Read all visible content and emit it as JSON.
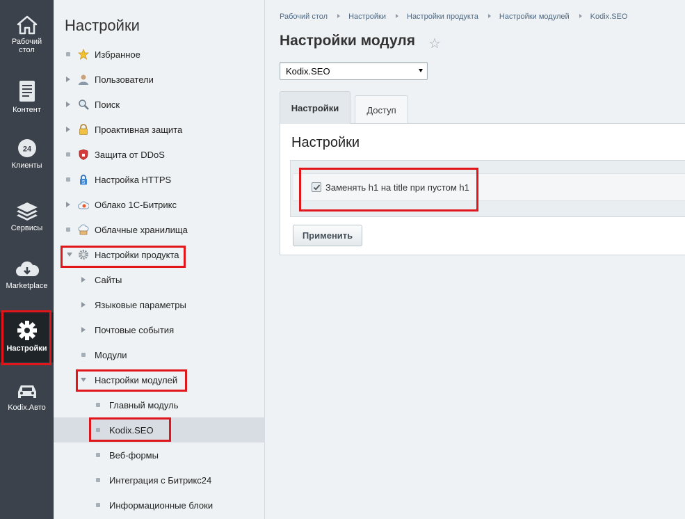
{
  "left_panel": {
    "items": [
      {
        "label": "Рабочий стол",
        "icon": "home-icon"
      },
      {
        "label": "Контент",
        "icon": "document-icon"
      },
      {
        "label": "Клиенты",
        "icon": "clients-24-icon"
      },
      {
        "label": "Сервисы",
        "icon": "layers-icon"
      },
      {
        "label": "Marketplace",
        "icon": "cloud-download-icon"
      },
      {
        "label": "Настройки",
        "icon": "gear-icon"
      },
      {
        "label": "Kodix.Авто",
        "icon": "car-icon"
      }
    ],
    "desktop_line1": "Рабочий",
    "desktop_line2": "стол"
  },
  "menu": {
    "title": "Настройки",
    "items": [
      {
        "label": "Избранное",
        "icon": "star-icon"
      },
      {
        "label": "Пользователи",
        "icon": "user-icon"
      },
      {
        "label": "Поиск",
        "icon": "magnifier-icon"
      },
      {
        "label": "Проактивная защита",
        "icon": "lock-icon"
      },
      {
        "label": "Защита от DDoS",
        "icon": "shield-icon"
      },
      {
        "label": "Настройка HTTPS",
        "icon": "https-lock-icon"
      },
      {
        "label": "Облако 1С-Битрикс",
        "icon": "cloud-icon"
      },
      {
        "label": "Облачные хранилища",
        "icon": "cloud-storage-icon"
      },
      {
        "label": "Настройки продукта",
        "icon": "gear-icon"
      },
      {
        "label": "Сайты"
      },
      {
        "label": "Языковые параметры"
      },
      {
        "label": "Почтовые события"
      },
      {
        "label": "Модули"
      },
      {
        "label": "Настройки модулей"
      },
      {
        "label": "Главный модуль"
      },
      {
        "label": "Kodix.SEO"
      },
      {
        "label": "Веб-формы"
      },
      {
        "label": "Интеграция с Битрикс24"
      },
      {
        "label": "Информационные блоки"
      }
    ]
  },
  "breadcrumb": [
    "Рабочий стол",
    "Настройки",
    "Настройки продукта",
    "Настройки модулей",
    "Kodix.SEO"
  ],
  "page_title": "Настройки модуля",
  "module_select": {
    "value": "Kodix.SEO"
  },
  "tabs": [
    {
      "label": "Настройки",
      "active": true
    },
    {
      "label": "Доступ",
      "active": false
    }
  ],
  "panel": {
    "title": "Настройки",
    "checkbox_label": "Заменять h1 на title при пустом h1",
    "checkbox_checked": true,
    "apply_label": "Применить"
  },
  "colors": {
    "highlight": "#e0161b",
    "sidebar_bg": "#3b424b",
    "link": "#4d6885"
  }
}
